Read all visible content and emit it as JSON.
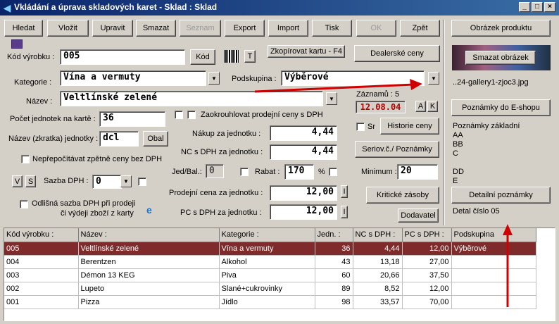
{
  "window": {
    "title": "Vkládání a úprava skladových karet  -  Sklad : Sklad"
  },
  "toolbar": {
    "hledat": "Hledat",
    "vlozit": "Vložit",
    "upravit": "Upravit",
    "smazat": "Smazat",
    "seznam": "Seznam",
    "export": "Export",
    "import": "Import",
    "tisk": "Tisk",
    "ok": "OK",
    "zpet": "Zpět"
  },
  "form": {
    "kod_label": "Kód výrobku :",
    "kod_value": "005",
    "kod_button": "Kód",
    "barcode_t": "T",
    "copy_button": "Zkopírovat kartu - F4",
    "dealer_button": "Dealerské ceny",
    "kategorie_label": "Kategorie :",
    "kategorie_value": "Vína a vermuty",
    "podskupina_label": "Podskupina :",
    "podskupina_value": "Výběrové",
    "nazev_label": "Název :",
    "nazev_value": "Veltlínské zelené",
    "zaznamu_label": "Záznamů : 5",
    "date_value": "12.08.04",
    "btn_a": "A",
    "btn_k": "K",
    "pocet_label": "Počet jednotek na kartě :",
    "pocet_value": "36",
    "zaokr_label": "Zaokrouhlovat prodejní ceny s DPH",
    "jednotka_label": "Název (zkratka) jednotky :",
    "jednotka_value": "dcl",
    "obal_button": "Obal",
    "sr_label": "Sr",
    "historie_button": "Historie ceny",
    "nakup_label": "Nákup za jednotku :",
    "nakup_value": "4,44",
    "nc_label": "NC s DPH za jednotku :",
    "nc_value": "4,44",
    "serio_button": "Seriov.č./ Poznámky",
    "neprepo_label": "Nepřepočítávat zpětně ceny bez DPH",
    "jedbal_label": "Jed/Bal.:",
    "jedbal_value": "0",
    "rabat_label": "Rabat :",
    "rabat_value": "170",
    "percent": "%",
    "minimum_label": "Minimum :",
    "minimum_value": "20",
    "btn_v": "V",
    "btn_s": "S",
    "sazba_label": "Sazba DPH :",
    "sazba_value": "0",
    "prodejni_label": "Prodejní cena za jednotku :",
    "prodejni_value": "12,00",
    "kriticke_button": "Kritické zásoby",
    "odlisna_label1": "Odlišná sazba DPH při prodeji",
    "odlisna_label2": "či výdeji zboží z karty",
    "pc_label": "PC  s DPH za jednotku :",
    "pc_value": "12,00",
    "dodavatel_button": "Dodavatel",
    "i_button": "I"
  },
  "side": {
    "obrazek_button": "Obrázek produktu",
    "smazat_obr_button": "Smazat obrázek",
    "filename": "..24-gallery1-zjoc3.jpg",
    "poznamky_eshop_button": "Poznámky do E-shopu",
    "poznamky_zakl_label": "Poznámky základní",
    "notes": [
      "AA",
      "BB",
      "C",
      "",
      "DD",
      "E"
    ],
    "detailni_button": "Detailní poznámky",
    "detal_label": "Detal číslo 05"
  },
  "table": {
    "headers": [
      "Kód výrobku :",
      "Název :",
      "Kategorie :",
      "Jedn. :",
      "NC s DPH :",
      "PC s DPH :",
      "Podskupina"
    ],
    "rows": [
      [
        "005",
        "Veltlínské zelené",
        "Vína a vermuty",
        "36",
        "4,44",
        "12,00",
        "Výběrové"
      ],
      [
        "004",
        "Berentzen",
        "Alkohol",
        "43",
        "13,18",
        "27,00",
        ""
      ],
      [
        "003",
        "Démon 13 KEG",
        "Piva",
        "60",
        "20,66",
        "37,50",
        ""
      ],
      [
        "002",
        "Lupeto",
        "Slané+cukrovinky",
        "89",
        "8,52",
        "12,00",
        ""
      ],
      [
        "001",
        "Pizza",
        "Jídlo",
        "98",
        "33,57",
        "70,00",
        ""
      ]
    ]
  },
  "colors": {
    "accent_red": "#d00000",
    "selected_row": "#7f2b2b",
    "date_text": "#b00000"
  }
}
